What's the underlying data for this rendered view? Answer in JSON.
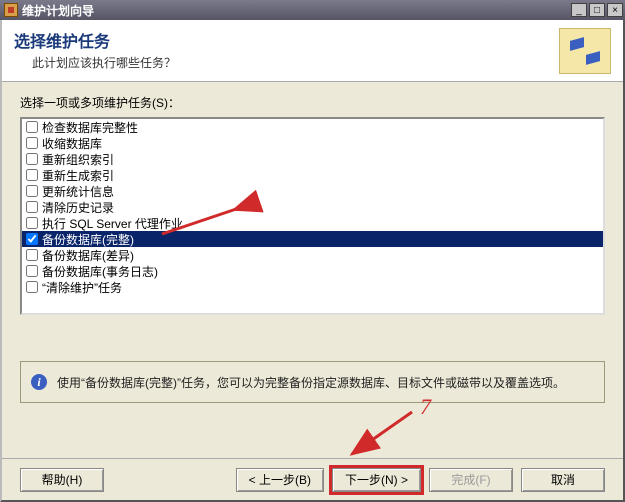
{
  "titlebar": {
    "title": "维护计划向导"
  },
  "header": {
    "title": "选择维护任务",
    "subtitle": "此计划应该执行哪些任务？"
  },
  "body": {
    "label": "选择一项或多项维护任务(S)：",
    "tasks": [
      {
        "label": "检查数据库完整性",
        "checked": false,
        "selected": false
      },
      {
        "label": "收缩数据库",
        "checked": false,
        "selected": false
      },
      {
        "label": "重新组织索引",
        "checked": false,
        "selected": false
      },
      {
        "label": "重新生成索引",
        "checked": false,
        "selected": false
      },
      {
        "label": "更新统计信息",
        "checked": false,
        "selected": false
      },
      {
        "label": "清除历史记录",
        "checked": false,
        "selected": false
      },
      {
        "label": "执行 SQL Server 代理作业",
        "checked": false,
        "selected": false
      },
      {
        "label": "备份数据库(完整)",
        "checked": true,
        "selected": true
      },
      {
        "label": "备份数据库(差异)",
        "checked": false,
        "selected": false
      },
      {
        "label": "备份数据库(事务日志)",
        "checked": false,
        "selected": false
      },
      {
        "label": "“清除维护”任务",
        "checked": false,
        "selected": false
      }
    ],
    "description": "使用“备份数据库(完整)”任务，您可以为完整备份指定源数据库、目标文件或磁带以及覆盖选项。"
  },
  "footer": {
    "help": "帮助(H)",
    "back": "< 上一步(B)",
    "next": "下一步(N) >",
    "finish": "完成(F)",
    "cancel": "取消"
  },
  "annotation": {
    "number": "7"
  }
}
